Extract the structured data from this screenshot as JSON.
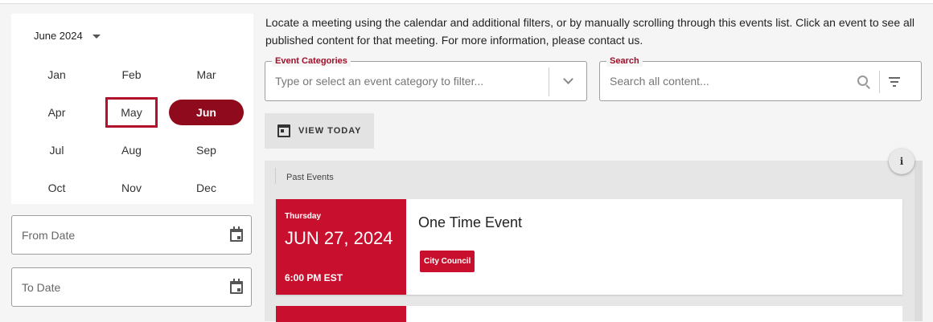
{
  "calendar": {
    "header_label": "June 2024",
    "months": [
      "Jan",
      "Feb",
      "Mar",
      "Apr",
      "May",
      "Jun",
      "Jul",
      "Aug",
      "Sep",
      "Oct",
      "Nov",
      "Dec"
    ],
    "focused_month": "May",
    "selected_month": "Jun"
  },
  "date_filters": {
    "from_placeholder": "From Date",
    "to_placeholder": "To Date"
  },
  "intro_text": "Locate a meeting using the calendar and additional filters, or by manually scrolling through this events list. Click an event to see all published content for that meeting. For more information, please contact us.",
  "filters": {
    "category_label": "Event Categories",
    "category_placeholder": "Type or select an event category to filter...",
    "search_label": "Search",
    "search_placeholder": "Search all content..."
  },
  "view_today_label": "VIEW TODAY",
  "info_button_glyph": "i",
  "events": {
    "section_label": "Past Events",
    "items": [
      {
        "weekday": "Thursday",
        "date": "JUN 27, 2024",
        "time": "6:00 PM EST",
        "title": "One Time Event",
        "category": "City Council"
      }
    ]
  },
  "colors": {
    "accent": "#c8102e",
    "selected_month": "#8e0a1c"
  }
}
